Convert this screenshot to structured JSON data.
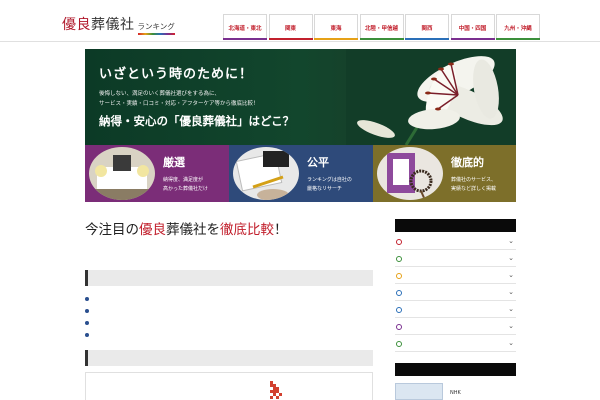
{
  "header": {
    "logo_red": "優良",
    "logo_main": "葬儀社",
    "logo_sub": "ランキング",
    "nav": [
      {
        "label": "北海道・東北",
        "color": "#7a2f8f"
      },
      {
        "label": "関東",
        "color": "#c2202d"
      },
      {
        "label": "東海",
        "color": "#e6a117"
      },
      {
        "label": "北陸・甲信越",
        "color": "#3b8f3a"
      },
      {
        "label": "関西",
        "color": "#2a6fb8"
      },
      {
        "label": "中国・四国",
        "color": "#7a2f8f"
      },
      {
        "label": "九州・沖縄",
        "color": "#3b8f3a"
      }
    ]
  },
  "hero": {
    "title": "いざという時のために！",
    "sub1": "後悔しない、満足のいく葬儀社選びをする為に、",
    "sub2": "サービス・実績・口コミ・対応・アフターケア等から徹底比較！",
    "main": "納得・安心の「優良葬儀社」はどこ？"
  },
  "features": [
    {
      "title": "厳選",
      "line1": "納得度、満足度が",
      "line2": "高かった葬儀社だけ"
    },
    {
      "title": "公平",
      "line1": "ランキングは自社の",
      "line2": "厳格なリサーチ"
    },
    {
      "title": "徹底的",
      "line1": "葬儀社のサービス、",
      "line2": "実績など詳しく掲載"
    }
  ],
  "headline": {
    "part1": "今注目の",
    "part2": "優良",
    "part3": "葬儀社を",
    "part4": "徹底比較",
    "part5": "！"
  },
  "sidebar": {
    "items": [
      {
        "color": "#c2202d"
      },
      {
        "color": "#3b8f3a"
      },
      {
        "color": "#e6a117"
      },
      {
        "color": "#2a6fb8"
      },
      {
        "color": "#2a6fb8"
      },
      {
        "color": "#7a2f8f"
      },
      {
        "color": "#3b8f3a"
      }
    ],
    "chevron": "⌄",
    "banner_text": "NHK"
  }
}
